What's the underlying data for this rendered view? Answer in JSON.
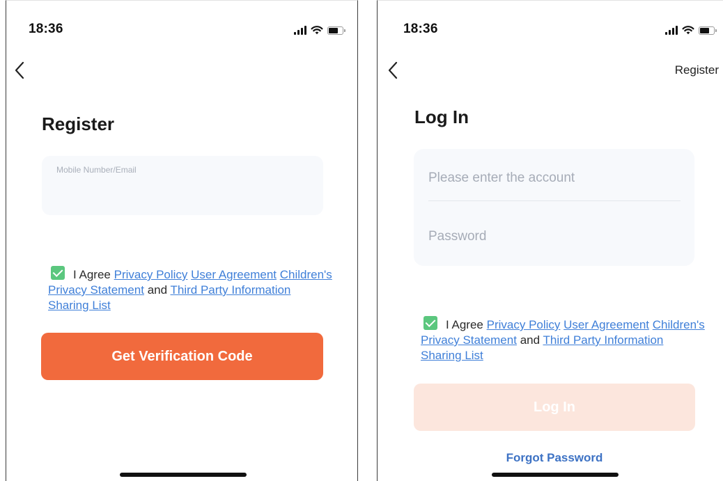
{
  "register_screen": {
    "status_time": "18:36",
    "title": "Register",
    "input_placeholder": "Mobile Number/Email",
    "agreement": {
      "prefix": "I Agree",
      "privacy_policy": "Privacy Policy",
      "user_agreement": "User Agreement",
      "children_privacy": "Children's Privacy Statement",
      "and": "and",
      "third_party": "Third Party Information Sharing List"
    },
    "primary_button": "Get Verification Code"
  },
  "login_screen": {
    "status_time": "18:36",
    "top_right_link": "Register",
    "title": "Log In",
    "account_placeholder": "Please enter the account",
    "password_placeholder": "Password",
    "agreement": {
      "prefix": "I Agree",
      "privacy_policy": "Privacy Policy",
      "user_agreement": "User Agreement",
      "children_privacy": "Children's Privacy Statement",
      "and": "and",
      "third_party": "Third Party Information Sharing List"
    },
    "primary_button": "Log In",
    "forgot_password": "Forgot Password"
  },
  "icons": {
    "back": "chevron-left-icon",
    "signal": "cellular-signal-icon",
    "wifi": "wifi-icon",
    "battery": "battery-icon",
    "checkbox": "checkmark-icon"
  },
  "colors": {
    "accent_orange": "#f16a3d",
    "disabled_orange": "#fce6dd",
    "link_blue": "#3f7fd8",
    "check_green": "#5bc77e",
    "input_bg": "#f7f9fc"
  }
}
